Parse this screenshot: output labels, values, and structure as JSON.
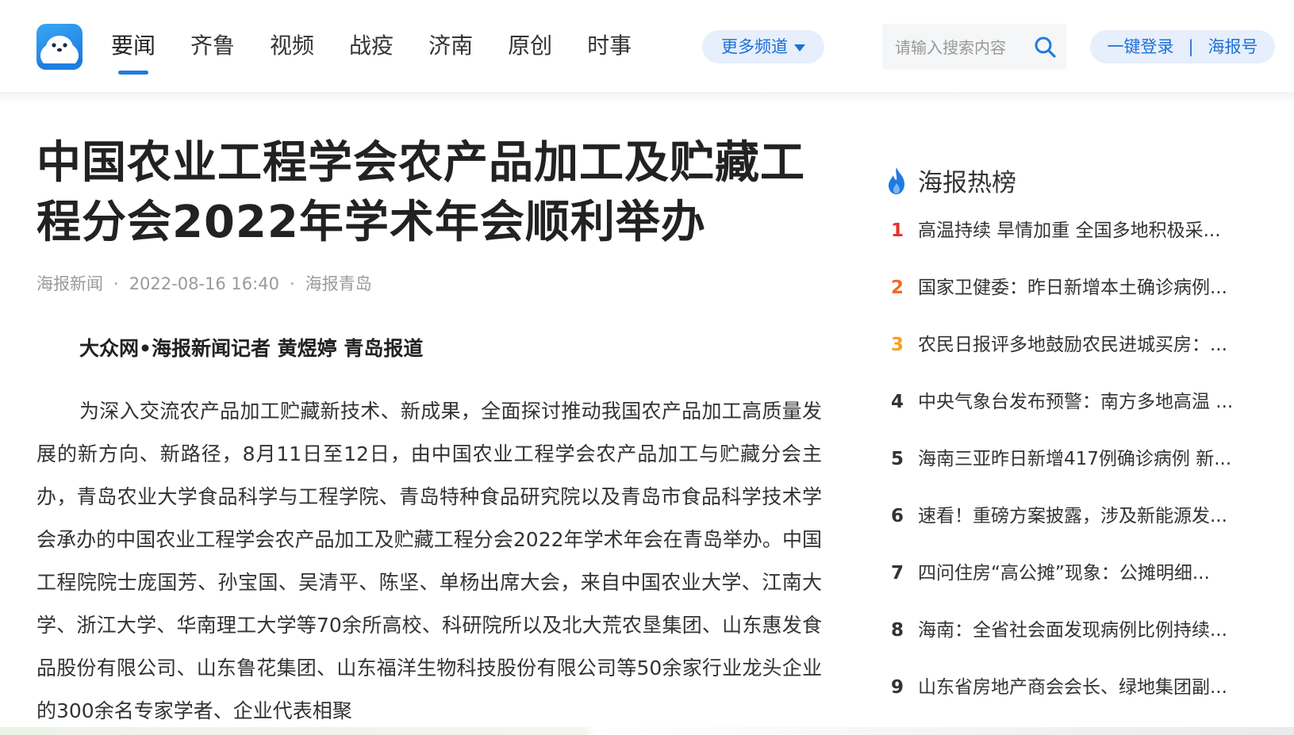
{
  "header": {
    "nav": [
      "要闻",
      "齐鲁",
      "视频",
      "战疫",
      "济南",
      "原创",
      "时事"
    ],
    "more_label": "更多频道",
    "search_placeholder": "请输入搜索内容",
    "login_label": "一键登录",
    "login_separator": "|",
    "haibao_label": "海报号"
  },
  "article": {
    "title": "中国农业工程学会农产品加工及贮藏工程分会2022年学术年会顺利举办",
    "source": "海报新闻",
    "datetime": "2022-08-16 16:40",
    "channel": "海报青岛",
    "dot": "·",
    "byline": "大众网•海报新闻记者 黄煜婷 青岛报道",
    "body": "为深入交流农产品加工贮藏新技术、新成果，全面探讨推动我国农产品加工高质量发展的新方向、新路径，8月11日至12日，由中国农业工程学会农产品加工与贮藏分会主办，青岛农业大学食品科学与工程学院、青岛特种食品研究院以及青岛市食品科学技术学会承办的中国农业工程学会农产品加工及贮藏工程分会2022年学术年会在青岛举办。中国工程院院士庞国芳、孙宝国、吴清平、陈坚、单杨出席大会，来自中国农业大学、江南大学、浙江大学、华南理工大学等70余所高校、科研院所以及北大荒农垦集团、山东惠发食品股份有限公司、山东鲁花集团、山东福洋生物科技股份有限公司等50余家行业龙头企业的300余名专家学者、企业代表相聚"
  },
  "sidebar": {
    "title": "海报热榜",
    "items": [
      {
        "rank": "1",
        "text": "高温持续 旱情加重 全国多地积极采..."
      },
      {
        "rank": "2",
        "text": "国家卫健委：昨日新增本土确诊病例..."
      },
      {
        "rank": "3",
        "text": "农民日报评多地鼓励农民进城买房：..."
      },
      {
        "rank": "4",
        "text": "中央气象台发布预警：南方多地高温 ..."
      },
      {
        "rank": "5",
        "text": "海南三亚昨日新增417例确诊病例 新..."
      },
      {
        "rank": "6",
        "text": "速看！重磅方案披露，涉及新能源发..."
      },
      {
        "rank": "7",
        "text": "四问住房“高公摊”现象：公摊明细..."
      },
      {
        "rank": "8",
        "text": "海南：全省社会面发现病例比例持续..."
      },
      {
        "rank": "9",
        "text": "山东省房地产商会会长、绿地集团副..."
      }
    ]
  },
  "colors": {
    "accent": "#1f7be0",
    "rank1": "#e8322d",
    "rank2": "#f06a24",
    "rank3": "#f3a21c"
  }
}
